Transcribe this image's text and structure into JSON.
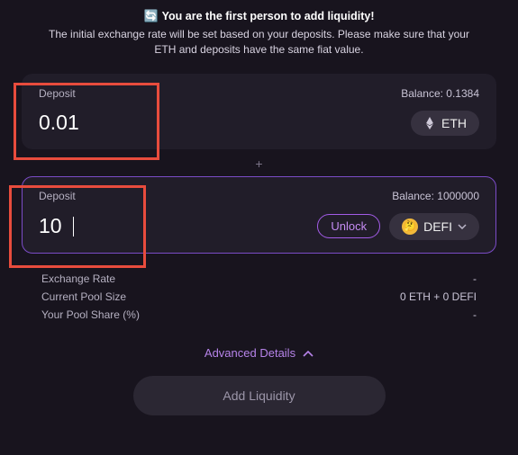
{
  "header": {
    "emoji": "🔄",
    "title": "You are the first person to add liquidity!",
    "subtitle": "The initial exchange rate will be set based on your deposits. Please make sure that your ETH and deposits have the same fiat value."
  },
  "deposit1": {
    "label": "Deposit",
    "balance_label": "Balance:",
    "balance": "0.1384",
    "value": "0.01",
    "token": "ETH"
  },
  "plus": "+",
  "deposit2": {
    "label": "Deposit",
    "balance_label": "Balance:",
    "balance": "1000000",
    "value": "10",
    "unlock": "Unlock",
    "token": "DEFI",
    "token_emoji": "🤔"
  },
  "stats": {
    "exchange_rate_label": "Exchange Rate",
    "exchange_rate_value": "-",
    "pool_size_label": "Current Pool Size",
    "pool_size_value": "0 ETH + 0 DEFI",
    "pool_share_label": "Your Pool Share (%)",
    "pool_share_value": "-"
  },
  "advanced": "Advanced Details",
  "add_liquidity": "Add Liquidity"
}
